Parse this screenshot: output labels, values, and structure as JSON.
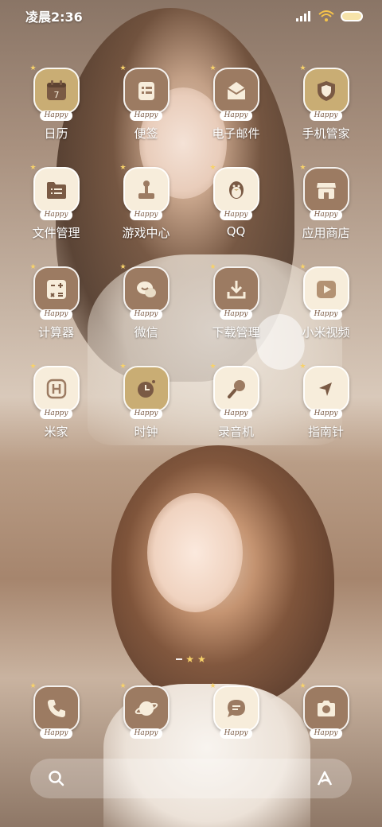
{
  "status_bar": {
    "time": "凌晨2:36",
    "signal_icon": "signal-bars-icon",
    "wifi_icon": "wifi-icon",
    "battery_icon": "battery-icon"
  },
  "badge_text": "Happy",
  "apps": [
    {
      "label": "日历",
      "icon": "calendar-icon",
      "tile": "gold"
    },
    {
      "label": "便签",
      "icon": "notes-icon",
      "tile": "brown"
    },
    {
      "label": "电子邮件",
      "icon": "mail-icon",
      "tile": "brown"
    },
    {
      "label": "手机管家",
      "icon": "shield-icon",
      "tile": "gold"
    },
    {
      "label": "文件管理",
      "icon": "folder-icon",
      "tile": "cream"
    },
    {
      "label": "游戏中心",
      "icon": "joystick-icon",
      "tile": "cream"
    },
    {
      "label": "QQ",
      "icon": "penguin-icon",
      "tile": "cream"
    },
    {
      "label": "应用商店",
      "icon": "store-icon",
      "tile": "brown"
    },
    {
      "label": "计算器",
      "icon": "calculator-icon",
      "tile": "brown"
    },
    {
      "label": "微信",
      "icon": "chat-bubbles-icon",
      "tile": "brown"
    },
    {
      "label": "下载管理",
      "icon": "download-icon",
      "tile": "brown"
    },
    {
      "label": "小米视频",
      "icon": "play-icon",
      "tile": "cream"
    },
    {
      "label": "米家",
      "icon": "home-icon",
      "tile": "cream"
    },
    {
      "label": "时钟",
      "icon": "clock-icon",
      "tile": "gold"
    },
    {
      "label": "录音机",
      "icon": "microphone-icon",
      "tile": "cream"
    },
    {
      "label": "指南针",
      "icon": "compass-icon",
      "tile": "cream"
    }
  ],
  "dock": [
    {
      "icon": "phone-icon",
      "tile": "brown"
    },
    {
      "icon": "planet-browser-icon",
      "tile": "brown"
    },
    {
      "icon": "message-icon",
      "tile": "cream"
    },
    {
      "icon": "camera-icon",
      "tile": "brown"
    }
  ],
  "search": {
    "search_icon": "search-icon",
    "assistant_icon": "assistant-icon"
  },
  "colors": {
    "tile_gold": "#c9ad74",
    "tile_brown": "#9c7b62",
    "tile_cream": "#f7eddb",
    "glyph_dark": "#7a5a44",
    "star": "#f7d26a"
  }
}
